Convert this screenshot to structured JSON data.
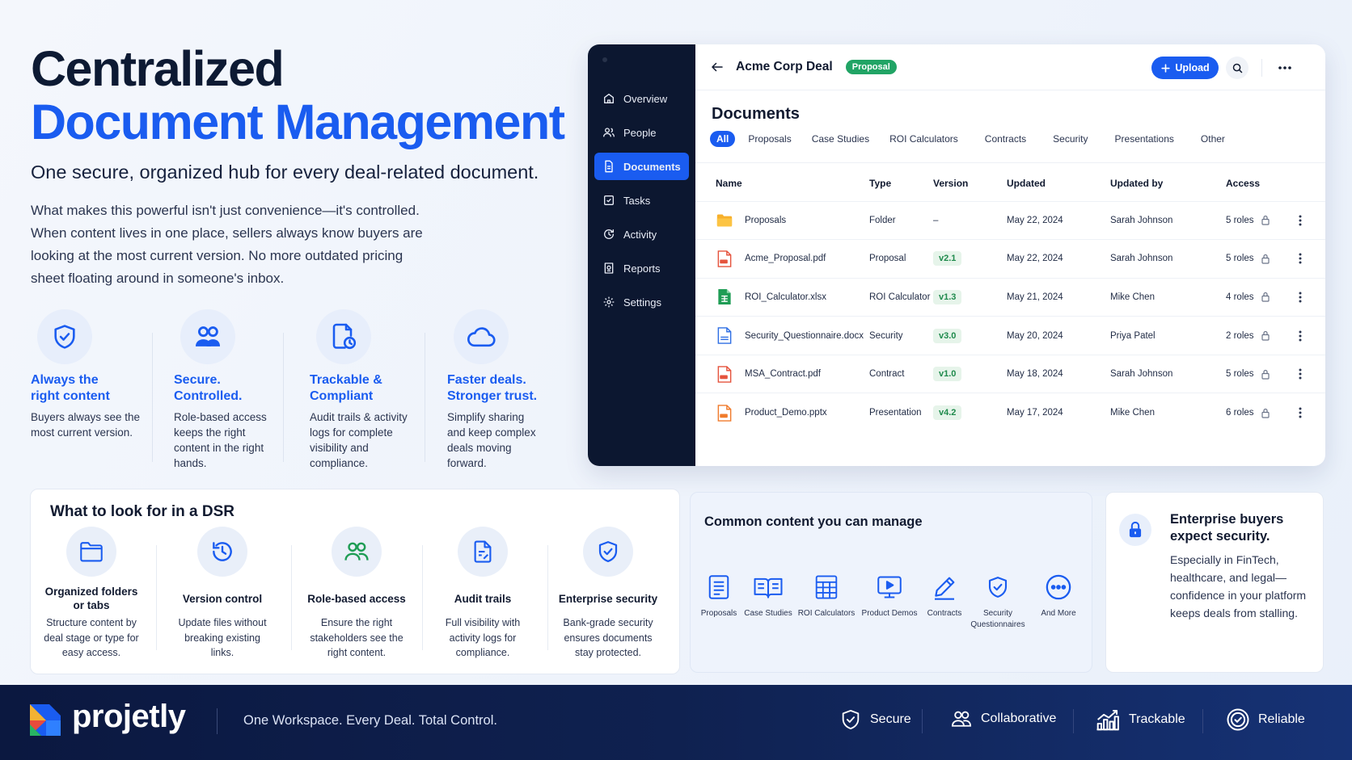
{
  "hero": {
    "title_line1": "Centralized",
    "title_line2": "Document Management",
    "subtitle": "One secure, organized hub for every deal-related document.",
    "body_line1": "What makes this powerful isn't just convenience—it's controlled.",
    "body_line2": "When content lives in one place, sellers always know buyers are",
    "body_line3": "looking at the most current version. No more outdated pricing",
    "body_line4": "sheet floating around in someone's inbox."
  },
  "features": [
    {
      "icon": "shield-check-icon",
      "title_1": "Always the",
      "title_2": "right content",
      "desc": "Buyers always see the most current version."
    },
    {
      "icon": "users-icon",
      "title_1": "Secure.",
      "title_2": "Controlled.",
      "desc": "Role-based access keeps the right content in the right hands."
    },
    {
      "icon": "document-clock-icon",
      "title_1": "Trackable &",
      "title_2": "Compliant",
      "desc": "Audit trails & activity logs for complete visibility and compliance."
    },
    {
      "icon": "cloud-icon",
      "title_1": "Faster deals.",
      "title_2": "Stronger trust.",
      "desc": "Simplify sharing and keep complex deals moving forward."
    }
  ],
  "app": {
    "sidebar": [
      {
        "label": "Overview",
        "icon": "home-icon"
      },
      {
        "label": "People",
        "icon": "people-icon"
      },
      {
        "label": "Documents",
        "icon": "document-icon",
        "active": true
      },
      {
        "label": "Tasks",
        "icon": "checkbox-icon"
      },
      {
        "label": "Activity",
        "icon": "activity-icon"
      },
      {
        "label": "Reports",
        "icon": "report-icon"
      },
      {
        "label": "Settings",
        "icon": "gear-icon"
      }
    ],
    "deal_title": "Acme Corp Deal",
    "deal_badge": "Proposal",
    "upload_label": "Upload",
    "section_title": "Documents",
    "tabs": [
      "All",
      "Proposals",
      "Case Studies",
      "ROI Calculators",
      "Contracts",
      "Security",
      "Presentations",
      "Other"
    ],
    "columns": [
      "Name",
      "Type",
      "Version",
      "Updated",
      "Updated by",
      "Access"
    ],
    "rows": [
      {
        "name": "Proposals",
        "type": "Folder",
        "version": "–",
        "updated": "May 22, 2024",
        "by": "Sarah Johnson",
        "access": "5 roles",
        "icon": "folder-icon"
      },
      {
        "name": "Acme_Proposal.pdf",
        "type": "Proposal",
        "version": "v2.1",
        "updated": "May 22, 2024",
        "by": "Sarah Johnson",
        "access": "5 roles",
        "icon": "pdf-icon"
      },
      {
        "name": "ROI_Calculator.xlsx",
        "type": "ROI Calculator",
        "version": "v1.3",
        "updated": "May 21, 2024",
        "by": "Mike Chen",
        "access": "4 roles",
        "icon": "xlsx-icon"
      },
      {
        "name": "Security_Questionnaire.docx",
        "type": "Security",
        "version": "v3.0",
        "updated": "May 20, 2024",
        "by": "Priya Patel",
        "access": "2 roles",
        "icon": "docx-icon"
      },
      {
        "name": "MSA_Contract.pdf",
        "type": "Contract",
        "version": "v1.0",
        "updated": "May 18, 2024",
        "by": "Sarah Johnson",
        "access": "5 roles",
        "icon": "pdf-icon"
      },
      {
        "name": "Product_Demo.pptx",
        "type": "Presentation",
        "version": "v4.2",
        "updated": "May 17, 2024",
        "by": "Mike Chen",
        "access": "6 roles",
        "icon": "pptx-icon"
      }
    ]
  },
  "dsr": {
    "title": "What to look for in a DSR",
    "items": [
      {
        "icon": "folder-icon",
        "title": "Organized folders or tabs",
        "desc": "Structure content by deal stage or type for easy access."
      },
      {
        "icon": "history-icon",
        "title": "Version control",
        "desc": "Update files without breaking existing links."
      },
      {
        "icon": "users-icon",
        "title": "Role-based access",
        "desc": "Ensure the right stakeholders see the right content."
      },
      {
        "icon": "document-edit-icon",
        "title": "Audit trails",
        "desc": "Full visibility with activity logs for compliance."
      },
      {
        "icon": "shield-check-icon",
        "title": "Enterprise security",
        "desc": "Bank-grade security ensures documents stay protected."
      }
    ]
  },
  "common": {
    "title": "Common content you can manage",
    "items": [
      {
        "label": "Proposals",
        "icon": "document-lines-icon"
      },
      {
        "label": "Case Studies",
        "icon": "book-icon"
      },
      {
        "label": "ROI Calculators",
        "icon": "grid-calculator-icon"
      },
      {
        "label": "Product Demos",
        "icon": "play-screen-icon"
      },
      {
        "label": "Contracts",
        "icon": "pen-icon"
      },
      {
        "label": "Security Questionnaires",
        "icon": "shield-check-icon"
      },
      {
        "label": "And More",
        "icon": "more-circle-icon"
      }
    ]
  },
  "enterprise": {
    "title": "Enterprise buyers expect security.",
    "body": "Especially in FinTech, healthcare, and legal—confidence in your platform keeps deals from stalling."
  },
  "footer": {
    "brand": "projetly",
    "tagline": "One Workspace. Every Deal. Total Control.",
    "badges": [
      {
        "label": "Secure",
        "icon": "shield-check-icon"
      },
      {
        "label": "Collaborative",
        "icon": "users-icon"
      },
      {
        "label": "Trackable",
        "icon": "chart-growth-icon"
      },
      {
        "label": "Reliable",
        "icon": "check-circle-icon"
      }
    ]
  },
  "colors": {
    "accent": "#1a5cf0",
    "sidebar": "#0c1730",
    "success": "#21a465",
    "footer": "#0f2150"
  }
}
